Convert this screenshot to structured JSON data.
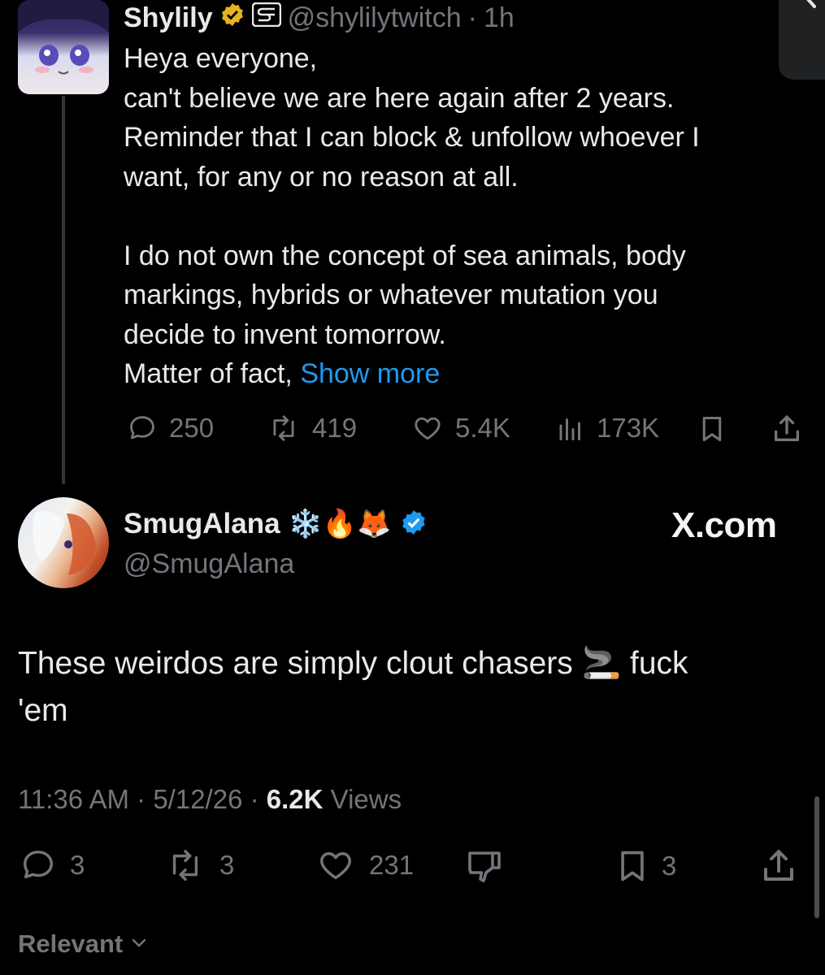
{
  "quoted_post": {
    "author_name": "Shylily",
    "author_handle": "@shylilytwitch",
    "time": "1h",
    "text_lines": [
      "Heya everyone,",
      "can't believe we are here again after 2 years.",
      "Reminder that I can block & unfollow whoever I",
      "want, for any or no reason at all.",
      "",
      "I do not own the concept of sea animals, body",
      "markings, hybrids or whatever mutation you",
      "decide to invent tomorrow.",
      "Matter of fact,"
    ],
    "show_more": "Show more",
    "actions": {
      "replies": "250",
      "reposts": "419",
      "likes": "5.4K",
      "views": "173K"
    }
  },
  "reply_post": {
    "author_name": "SmugAlana",
    "author_emojis": "❄️🔥🦊",
    "author_handle": "@SmugAlana",
    "text_line1": "These weirdos are simply clout chasers 🚬 fuck",
    "text_line2": "'em",
    "time": "11:36 AM",
    "date": "5/12/26",
    "views_count": "6.2K",
    "views_label": "Views",
    "actions": {
      "replies": "3",
      "reposts": "3",
      "likes": "231",
      "bookmarks": "3"
    }
  },
  "watermark": "X.com",
  "sort_label": "Relevant",
  "colors": {
    "background": "#000000",
    "text": "#e7e9ea",
    "muted": "#71767b",
    "link": "#1d9bf0",
    "gold_badge": "#e5b322"
  }
}
